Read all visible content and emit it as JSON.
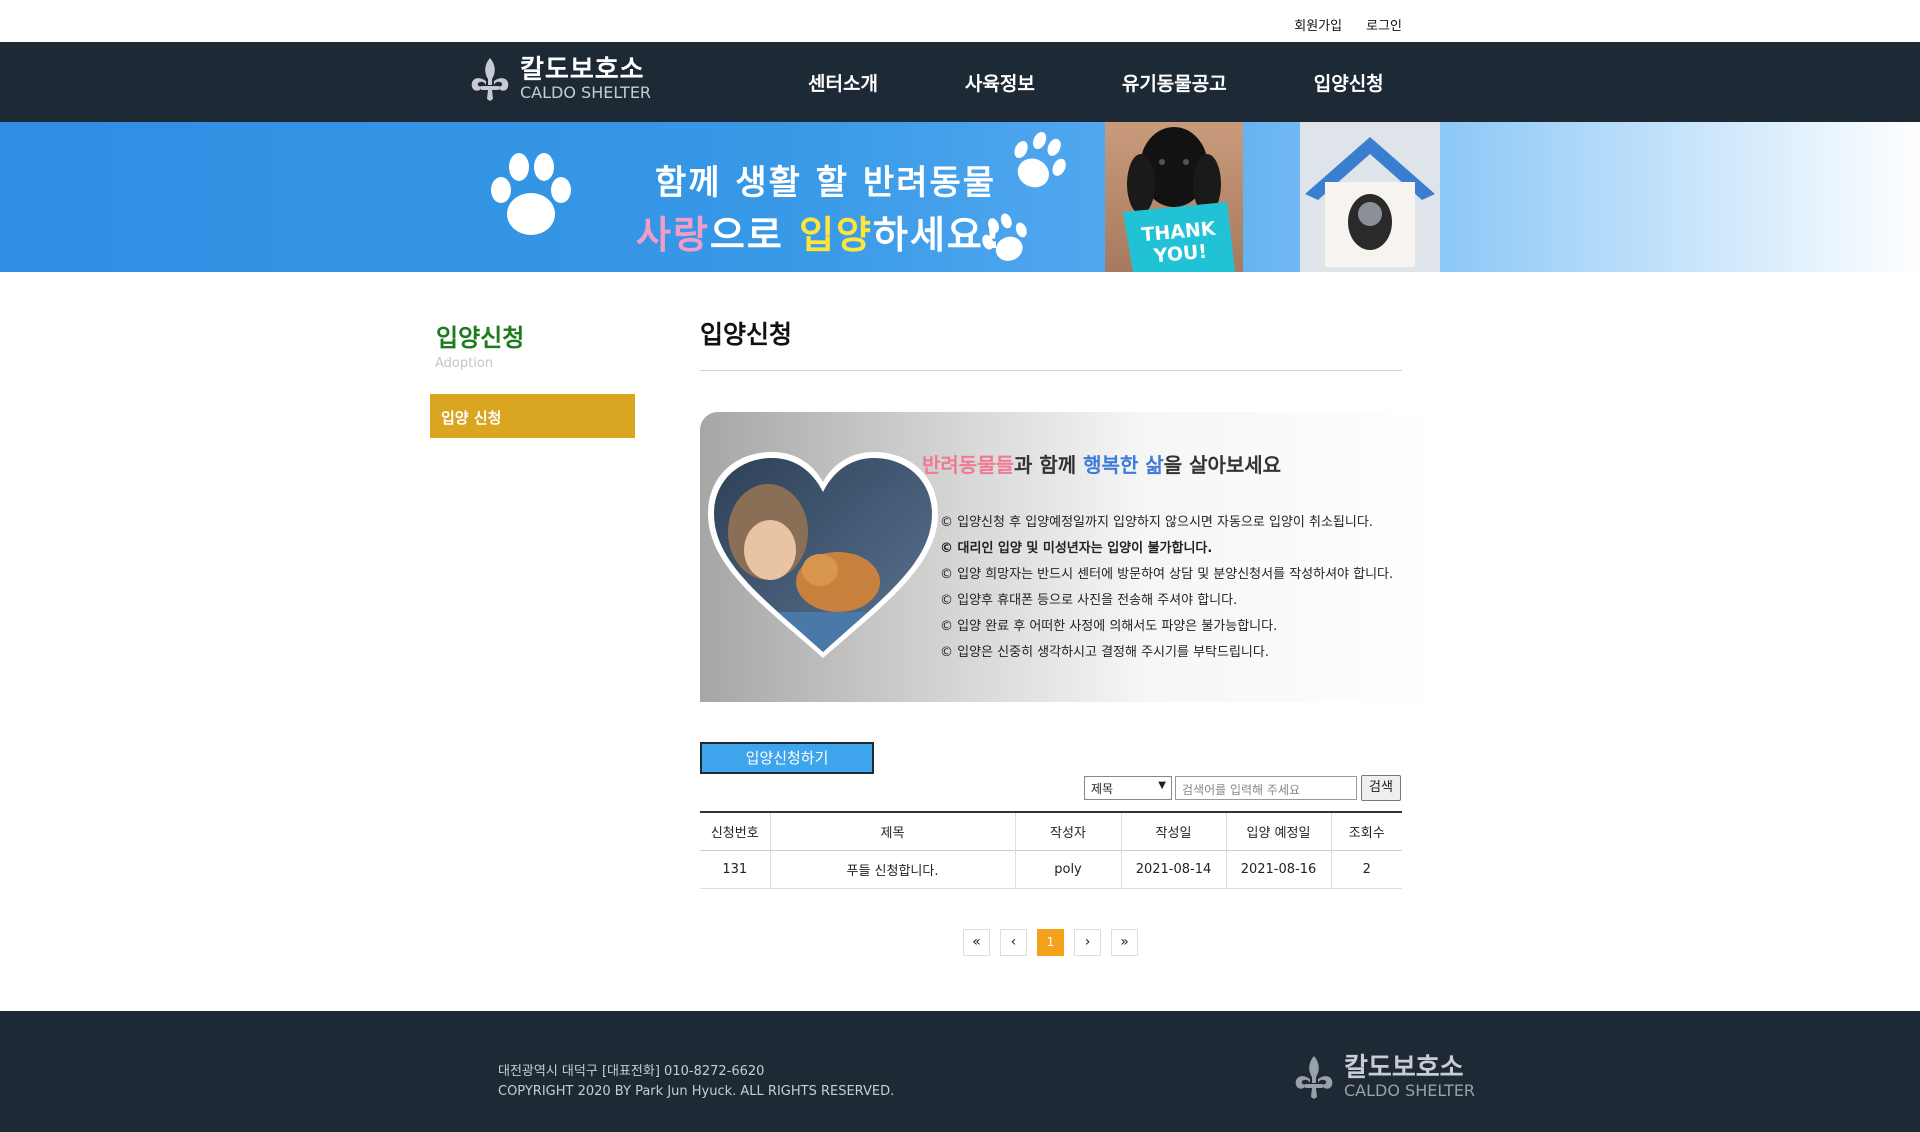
{
  "top_links": {
    "signup": "회원가입",
    "login": "로그인"
  },
  "brand": {
    "name_ko": "칼도보호소",
    "name_en": "CALDO SHELTER"
  },
  "nav": [
    "센터소개",
    "사육정보",
    "유기동물공고",
    "입양신청"
  ],
  "banner": {
    "line1": "함께 생활 할 반려동물",
    "line2_part1": "사랑",
    "line2_part2": "으로 ",
    "line2_part3": "입양",
    "line2_part4": "하세요!",
    "sign_text_1": "THANK",
    "sign_text_2": "YOU!"
  },
  "sidebar": {
    "title": "입양신청",
    "subtitle": "Adoption",
    "item": "입양 신청"
  },
  "content": {
    "title": "입양신청",
    "notice_headline_1": "반려동물들",
    "notice_headline_2": "과 함께 ",
    "notice_headline_3": "행복한 삶",
    "notice_headline_4": "을 살아보세요",
    "notice_items": [
      "© 입양신청 후 입양예정일까지 입양하지 않으시면 자동으로 입양이 취소됩니다.",
      "© 대리인 입양 및 미성년자는 입양이 불가합니다.",
      "© 입양 희망자는 반드시 센터에 방문하여 상담 및 분양신청서를 작성하셔야 합니다.",
      "© 입양후 휴대폰 등으로 사진을 전송해 주셔야 합니다.",
      "© 입양 완료 후 어떠한 사정에 의해서도 파양은 불가능합니다.",
      "© 입양은 신중히 생각하시고 결정해 주시기를 부탁드립니다."
    ],
    "apply_button": "입양신청하기",
    "search": {
      "select_value": "제목",
      "placeholder": "검색어를 입력해 주세요",
      "button": "검색"
    },
    "table": {
      "headers": [
        "신청번호",
        "제목",
        "작성자",
        "작성일",
        "입양 예정일",
        "조회수"
      ],
      "rows": [
        [
          "131",
          "푸들 신청합니다.",
          "poly",
          "2021-08-14",
          "2021-08-16",
          "2"
        ]
      ]
    },
    "pager": {
      "first": "«",
      "prev": "‹",
      "current": "1",
      "next": "›",
      "last": "»"
    }
  },
  "footer": {
    "address": "대전광역시 대덕구 [대표전화] 010-8272-6620",
    "copyright": "COPYRIGHT 2020 BY Park Jun Hyuck. ALL RIGHTS RESERVED."
  },
  "colors": {
    "nav_bg": "#1e2936",
    "sidebar_active": "#daa520",
    "sidebar_title": "#1d7a1d",
    "apply_button": "#3ea4ec",
    "pager_active": "#f4a21b"
  }
}
